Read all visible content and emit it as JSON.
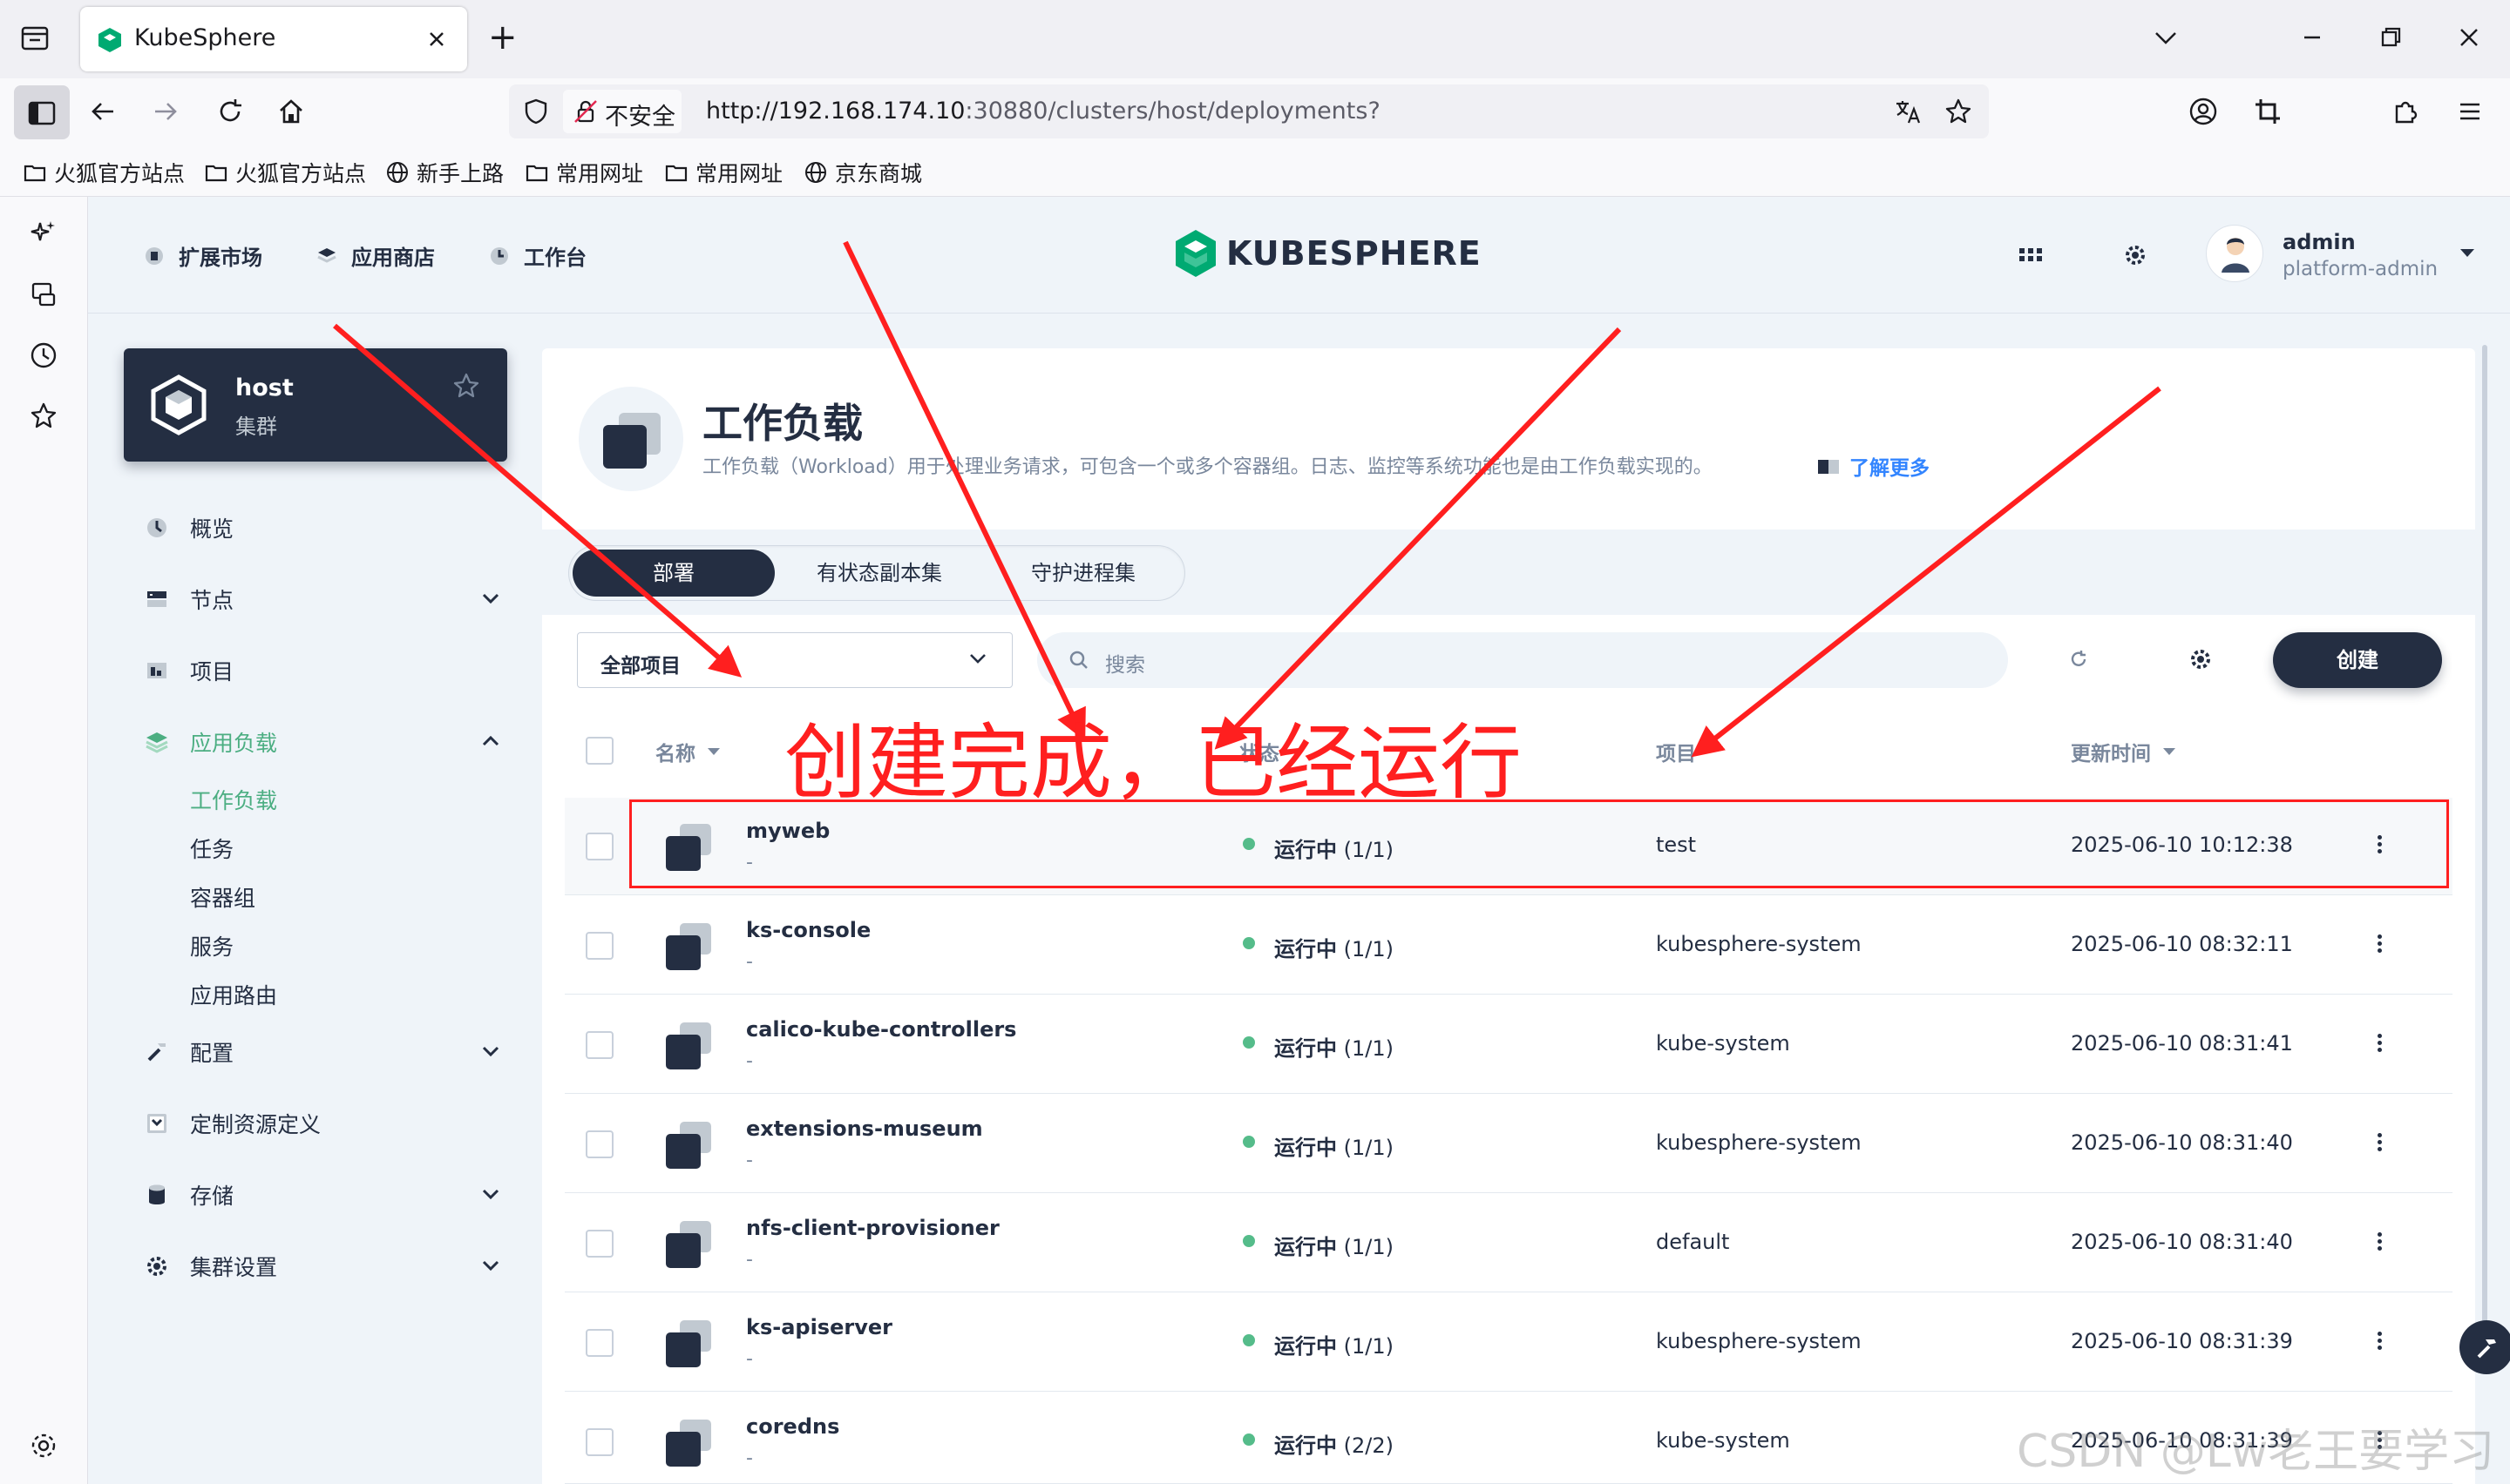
{
  "browser": {
    "tab_title": "KubeSphere",
    "new_tab": "+",
    "security_label": "不安全",
    "url_host": "http://192.168.174.10",
    "url_rest": ":30880/clusters/host/deployments?",
    "bookmarks": [
      {
        "label": "火狐官方站点",
        "icon": "folder-icon"
      },
      {
        "label": "火狐官方站点",
        "icon": "folder-icon"
      },
      {
        "label": "新手上路",
        "icon": "globe-icon"
      },
      {
        "label": "常用网址",
        "icon": "folder-icon"
      },
      {
        "label": "常用网址",
        "icon": "folder-icon"
      },
      {
        "label": "京东商城",
        "icon": "globe-icon"
      }
    ]
  },
  "header": {
    "links": [
      {
        "label": "扩展市场",
        "icon": "extensions-icon"
      },
      {
        "label": "应用商店",
        "icon": "app-store-icon"
      },
      {
        "label": "工作台",
        "icon": "workbench-icon"
      }
    ],
    "logo_text": "KUBESPHERE",
    "user": {
      "name": "admin",
      "role": "platform-admin"
    }
  },
  "sidebar": {
    "cluster": {
      "name": "host",
      "type": "集群"
    },
    "menu": [
      {
        "label": "概览",
        "icon": "dashboard-icon",
        "expandable": false
      },
      {
        "label": "节点",
        "icon": "nodes-icon",
        "expandable": true
      },
      {
        "label": "项目",
        "icon": "project-icon",
        "expandable": false
      },
      {
        "label": "应用负载",
        "icon": "app-workload-icon",
        "expandable": true,
        "expanded": true,
        "active": true
      },
      {
        "label": "配置",
        "icon": "config-icon",
        "expandable": true
      },
      {
        "label": "定制资源定义",
        "icon": "crd-icon",
        "expandable": false
      },
      {
        "label": "存储",
        "icon": "storage-icon",
        "expandable": true
      },
      {
        "label": "集群设置",
        "icon": "settings-icon",
        "expandable": true
      }
    ],
    "submenu": [
      "工作负载",
      "任务",
      "容器组",
      "服务",
      "应用路由"
    ],
    "active_submenu": "工作负载"
  },
  "page": {
    "title": "工作负载",
    "description": "工作负载（Workload）用于处理业务请求，可包含一个或多个容器组。日志、监控等系统功能也是由工作负载实现的。",
    "learn_more": "了解更多",
    "tabs": [
      "部署",
      "有状态副本集",
      "守护进程集"
    ],
    "active_tab": "部署"
  },
  "toolbar": {
    "project_select": "全部项目",
    "search_placeholder": "搜索",
    "create_label": "创建"
  },
  "table": {
    "columns": [
      "名称",
      "状态",
      "项目",
      "更新时间"
    ],
    "rows": [
      {
        "name": "myweb",
        "desc": "-",
        "status": "运行中",
        "replicas": "(1/1)",
        "project": "test",
        "updated": "2025-06-10 10:12:38",
        "highlighted": true
      },
      {
        "name": "ks-console",
        "desc": "-",
        "status": "运行中",
        "replicas": "(1/1)",
        "project": "kubesphere-system",
        "updated": "2025-06-10 08:32:11"
      },
      {
        "name": "calico-kube-controllers",
        "desc": "-",
        "status": "运行中",
        "replicas": "(1/1)",
        "project": "kube-system",
        "updated": "2025-06-10 08:31:41"
      },
      {
        "name": "extensions-museum",
        "desc": "-",
        "status": "运行中",
        "replicas": "(1/1)",
        "project": "kubesphere-system",
        "updated": "2025-06-10 08:31:40"
      },
      {
        "name": "nfs-client-provisioner",
        "desc": "-",
        "status": "运行中",
        "replicas": "(1/1)",
        "project": "default",
        "updated": "2025-06-10 08:31:40"
      },
      {
        "name": "ks-apiserver",
        "desc": "-",
        "status": "运行中",
        "replicas": "(1/1)",
        "project": "kubesphere-system",
        "updated": "2025-06-10 08:31:39"
      },
      {
        "name": "coredns",
        "desc": "-",
        "status": "运行中",
        "replicas": "(2/2)",
        "project": "kube-system",
        "updated": "2025-06-10 08:31:39"
      }
    ]
  },
  "annotation": {
    "text": "创建完成，已经运行",
    "color": "#ff1f1f"
  },
  "watermark": "CSDN @Lw老王要学习",
  "colors": {
    "dark": "#242e42",
    "green": "#55bc8a",
    "active_green": "#4cae82",
    "link_blue": "#3385ff",
    "annotation_red": "#ff1f1f"
  }
}
